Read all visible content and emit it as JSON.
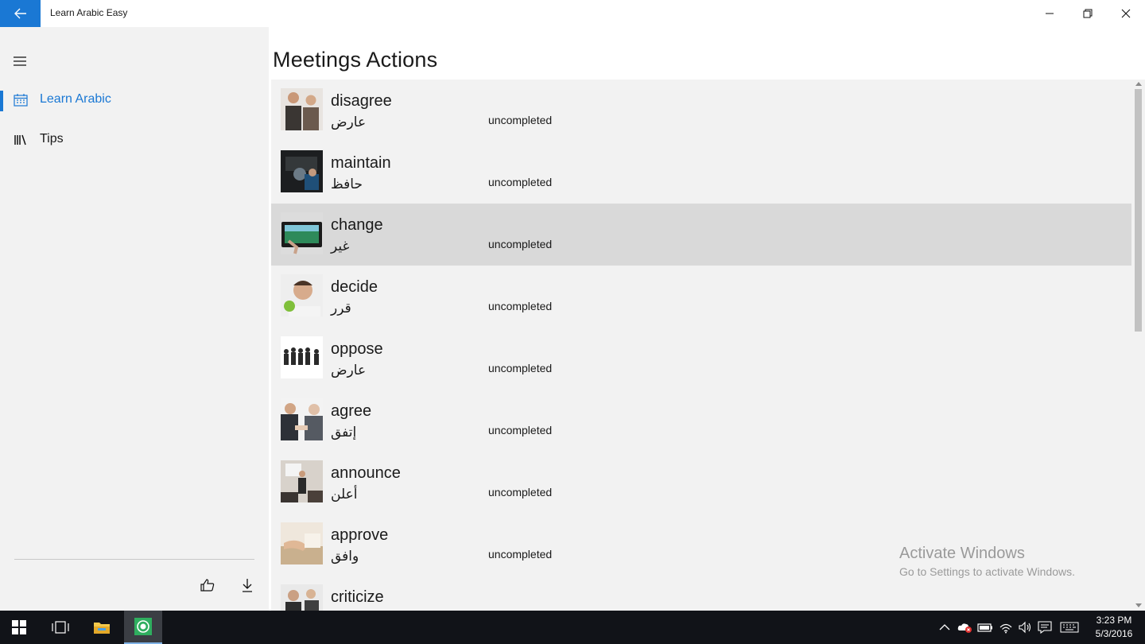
{
  "app": {
    "title": "Learn Arabic Easy",
    "accent_color": "#1a78d4"
  },
  "titlebar": {
    "back_icon": "arrow-left-icon",
    "minimize_icon": "minimize-icon",
    "restore_icon": "restore-icon",
    "close_icon": "close-icon"
  },
  "sidebar": {
    "menu_icon": "hamburger-icon",
    "items": [
      {
        "label": "Learn Arabic",
        "icon": "calendar-icon",
        "active": true
      },
      {
        "label": "Tips",
        "icon": "library-icon",
        "active": false
      }
    ],
    "actions": [
      {
        "icon": "thumbs-up-icon"
      },
      {
        "icon": "download-icon"
      }
    ]
  },
  "main": {
    "page_title": "Meetings Actions",
    "words": [
      {
        "english": "disagree",
        "arabic": "عارض",
        "status": "uncompleted"
      },
      {
        "english": "maintain",
        "arabic": "حافظ",
        "status": "uncompleted"
      },
      {
        "english": "change",
        "arabic": "غير",
        "status": "uncompleted",
        "selected": true
      },
      {
        "english": "decide",
        "arabic": "قرر",
        "status": "uncompleted"
      },
      {
        "english": "oppose",
        "arabic": "عارض",
        "status": "uncompleted"
      },
      {
        "english": "agree",
        "arabic": "إتفق",
        "status": "uncompleted"
      },
      {
        "english": "announce",
        "arabic": "أعلن",
        "status": "uncompleted"
      },
      {
        "english": "approve",
        "arabic": "وافق",
        "status": "uncompleted"
      },
      {
        "english": "criticize",
        "arabic": "",
        "status": ""
      }
    ]
  },
  "watermark": {
    "line1": "Activate Windows",
    "line2": "Go to Settings to activate Windows."
  },
  "taskbar": {
    "time": "3:23 PM",
    "date": "5/3/2016"
  }
}
